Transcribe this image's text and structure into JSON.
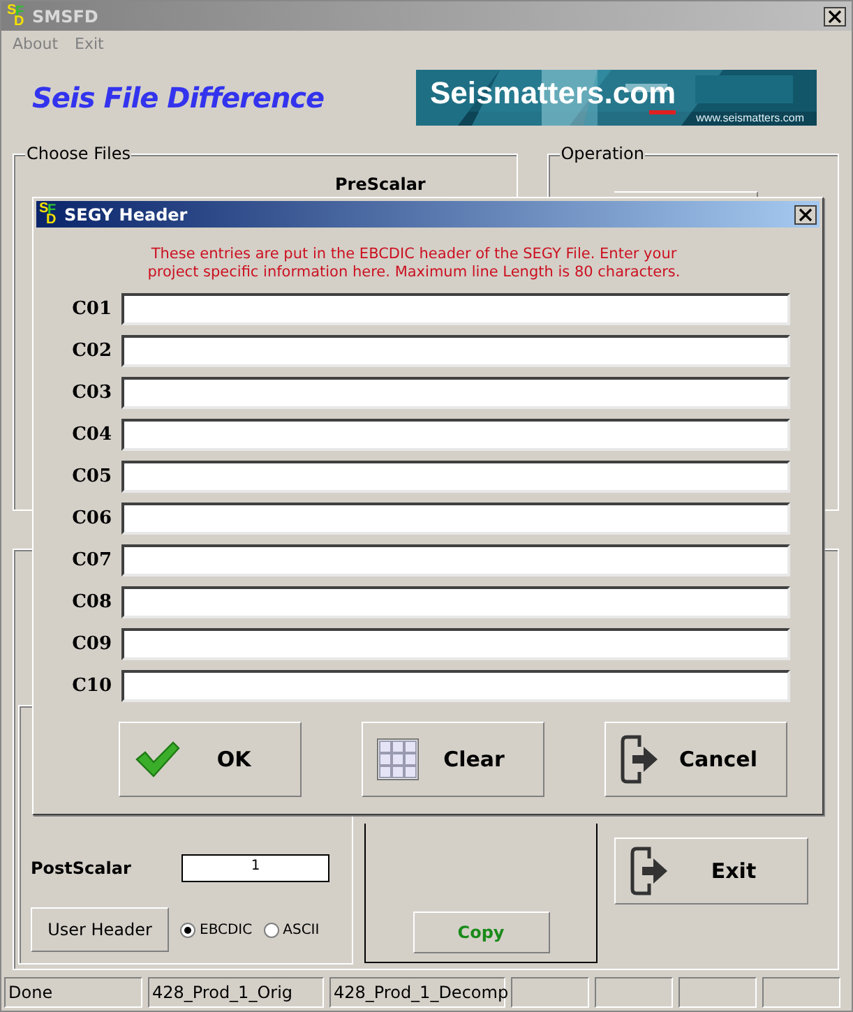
{
  "window": {
    "logo": [
      "S",
      "F",
      "D"
    ],
    "title": "SMSFD"
  },
  "menu": [
    {
      "label": "About"
    },
    {
      "label": "Exit"
    }
  ],
  "app_title": "Seis File Difference",
  "banner": {
    "brand": "Seismatters.co",
    "brand_end": "m",
    "url": "www.seismatters.com"
  },
  "choose_files": {
    "title": "Choose Files",
    "label": "PreScalar"
  },
  "operation": {
    "title": "Operation"
  },
  "post_scalar": {
    "label": "PostScalar",
    "value": "1"
  },
  "user_header": "User Header",
  "encoding": [
    {
      "label": "EBCDIC",
      "selected": true
    },
    {
      "label": "ASCII",
      "selected": false
    }
  ],
  "copy": "Copy",
  "exit": "Exit",
  "status_bar": [
    "Done",
    "428_Prod_1_Orig",
    "428_Prod_1_Decomp"
  ],
  "dialog": {
    "logo": [
      "S",
      "F",
      "D"
    ],
    "title": "SEGY Header",
    "message": "These entries are put in the EBCDIC header of the SEGY File. Enter your project specific information here. Maximum line Length is 80 characters.",
    "fields": [
      {
        "label": "C01"
      },
      {
        "label": "C02"
      },
      {
        "label": "C03"
      },
      {
        "label": "C04"
      },
      {
        "label": "C05"
      },
      {
        "label": "C06"
      },
      {
        "label": "C07"
      },
      {
        "label": "C08"
      },
      {
        "label": "C09"
      },
      {
        "label": "C10"
      }
    ],
    "buttons": [
      {
        "kind": "ok",
        "label": "OK"
      },
      {
        "kind": "clear",
        "label": "Clear"
      },
      {
        "kind": "cancel",
        "label": "Cancel"
      }
    ]
  }
}
